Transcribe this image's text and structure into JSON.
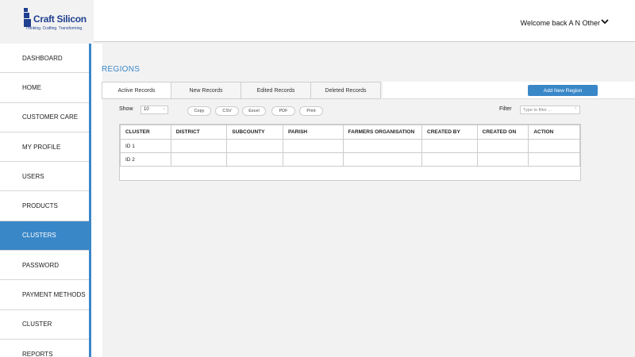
{
  "brand": {
    "name": "Craft Silicon",
    "tagline": "Thinking. Crafting. Transforming.",
    "color": "#1f3f8f"
  },
  "header": {
    "welcome": "Welcome back A N Other"
  },
  "sidebar": {
    "accent": "#3a87c8",
    "items": [
      {
        "label": "DASHBOARD",
        "active": false
      },
      {
        "label": "HOME",
        "active": false
      },
      {
        "label": "CUSTOMER CARE",
        "active": false
      },
      {
        "label": "MY PROFILE",
        "active": false
      },
      {
        "label": "USERS",
        "active": false
      },
      {
        "label": "PRODUCTS",
        "active": false
      },
      {
        "label": "CLUSTERS",
        "active": true
      },
      {
        "label": "PASSWORD",
        "active": false
      },
      {
        "label": "PAYMENT METHODS",
        "active": false
      },
      {
        "label": "CLUSTER",
        "active": false
      },
      {
        "label": "REPORTS",
        "active": false
      }
    ]
  },
  "main": {
    "title": "REGIONS",
    "tabs": [
      {
        "label": "Active Records",
        "active": true
      },
      {
        "label": "New Records",
        "active": false
      },
      {
        "label": "Edited Records",
        "active": false
      },
      {
        "label": "Deleted Records",
        "active": false
      }
    ],
    "add_button": "Add New Region",
    "show_label": "Show",
    "show_value": "10",
    "export_buttons": [
      "Copy",
      "CSV",
      "Excel",
      "PDF",
      "Print"
    ],
    "filter_label": "Filter",
    "filter_placeholder": "Type to filter ..."
  },
  "table": {
    "columns": [
      "CLUSTER",
      "DISTRICT",
      "SUBCOUNTY",
      "PARISH",
      "FARMERS ORGANISATION",
      "CREATED BY",
      "CREATED ON",
      "ACTION"
    ],
    "rows": [
      [
        "ID 1",
        "",
        "",
        "",
        "",
        "",
        "",
        ""
      ],
      [
        "ID 2",
        "",
        "",
        "",
        "",
        "",
        "",
        ""
      ]
    ]
  }
}
